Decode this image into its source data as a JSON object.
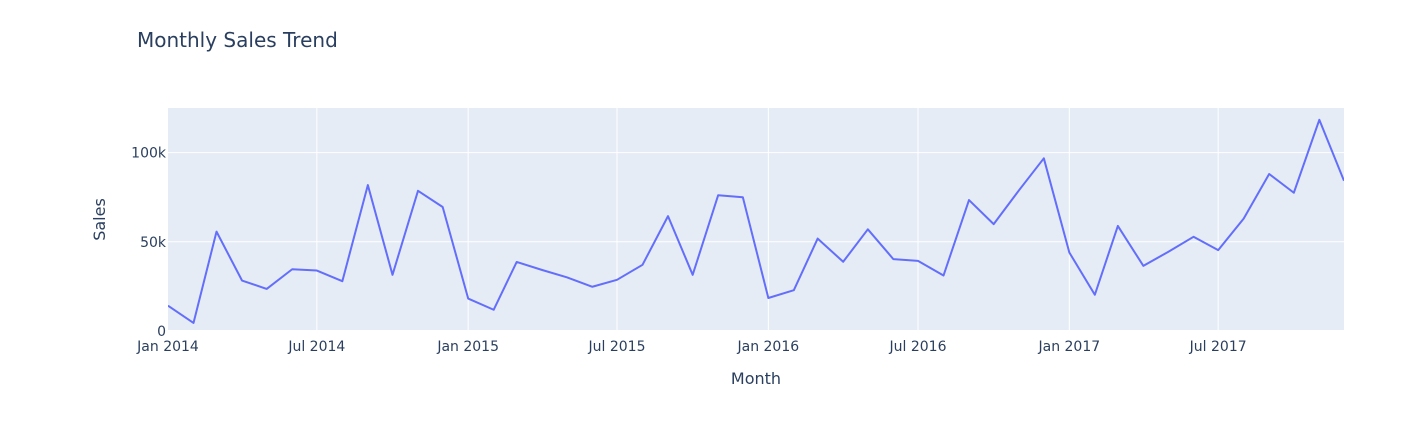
{
  "chart_data": {
    "type": "line",
    "title": "Monthly Sales Trend",
    "xlabel": "Month",
    "ylabel": "Sales",
    "xlim": [
      "2014-01-01",
      "2017-12-01"
    ],
    "ylim": [
      0,
      125000
    ],
    "grid": true,
    "legend": "none",
    "colors": {
      "line": "#636efa",
      "plot_background": "#e5ecf6",
      "grid": "#ffffff",
      "text": "#2a3f5f"
    },
    "x_ticks": [
      {
        "value": "2014-01-01",
        "label": "Jan 2014"
      },
      {
        "value": "2014-07-01",
        "label": "Jul 2014"
      },
      {
        "value": "2015-01-01",
        "label": "Jan 2015"
      },
      {
        "value": "2015-07-01",
        "label": "Jul 2015"
      },
      {
        "value": "2016-01-01",
        "label": "Jan 2016"
      },
      {
        "value": "2016-07-01",
        "label": "Jul 2016"
      },
      {
        "value": "2017-01-01",
        "label": "Jan 2017"
      },
      {
        "value": "2017-07-01",
        "label": "Jul 2017"
      }
    ],
    "y_ticks": [
      {
        "value": 0,
        "label": "0"
      },
      {
        "value": 50000,
        "label": "50k"
      },
      {
        "value": 100000,
        "label": "100k"
      }
    ],
    "x": [
      "2014-01-01",
      "2014-02-01",
      "2014-03-01",
      "2014-04-01",
      "2014-05-01",
      "2014-06-01",
      "2014-07-01",
      "2014-08-01",
      "2014-09-01",
      "2014-10-01",
      "2014-11-01",
      "2014-12-01",
      "2015-01-01",
      "2015-02-01",
      "2015-03-01",
      "2015-04-01",
      "2015-05-01",
      "2015-06-01",
      "2015-07-01",
      "2015-08-01",
      "2015-09-01",
      "2015-10-01",
      "2015-11-01",
      "2015-12-01",
      "2016-01-01",
      "2016-02-01",
      "2016-03-01",
      "2016-04-01",
      "2016-05-01",
      "2016-06-01",
      "2016-07-01",
      "2016-08-01",
      "2016-09-01",
      "2016-10-01",
      "2016-11-01",
      "2016-12-01",
      "2017-01-01",
      "2017-02-01",
      "2017-03-01",
      "2017-04-01",
      "2017-05-01",
      "2017-06-01",
      "2017-07-01",
      "2017-08-01",
      "2017-09-01",
      "2017-10-01",
      "2017-11-01",
      "2017-12-01"
    ],
    "series": [
      {
        "values": [
          14200,
          4500,
          55700,
          28300,
          23600,
          34600,
          33900,
          27900,
          81800,
          31500,
          78600,
          69500,
          18200,
          11900,
          38700,
          34200,
          30100,
          24800,
          28700,
          37100,
          64400,
          31500,
          76100,
          75000,
          18500,
          22900,
          51800,
          38800,
          57000,
          40300,
          39300,
          31100,
          73400,
          59900,
          79000,
          96800,
          44000,
          20300,
          58900,
          36500,
          44300,
          52800,
          45300,
          63000,
          88000,
          77500,
          118400,
          84200
        ]
      }
    ]
  }
}
